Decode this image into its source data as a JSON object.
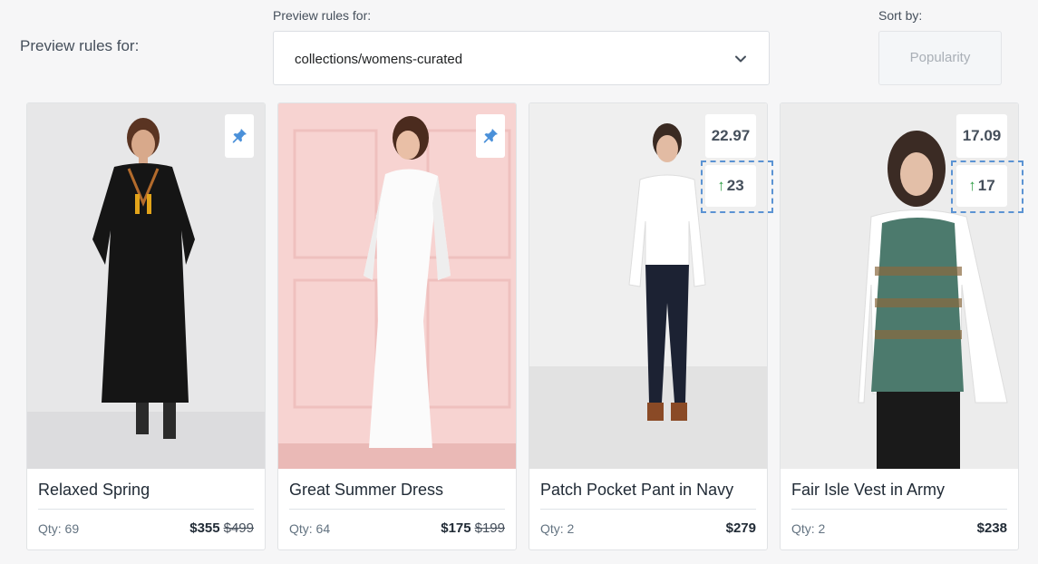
{
  "header": {
    "left_label": "Preview rules for:",
    "collection_label": "Preview rules for:",
    "collection_value": "collections/womens-curated",
    "sort_label": "Sort by:",
    "sort_placeholder": "Popularity"
  },
  "products": [
    {
      "title": "Relaxed Spring",
      "qty": "Qty: 69",
      "price": "$355",
      "compare_price": "$499",
      "pinned": true,
      "icon": "pin-icon"
    },
    {
      "title": "Great Summer Dress",
      "qty": "Qty: 64",
      "price": "$175",
      "compare_price": "$199",
      "pinned": true,
      "icon": "pin-icon"
    },
    {
      "title": "Patch Pocket Pant in Navy",
      "qty": "Qty: 2",
      "price": "$279",
      "score": "22.97",
      "rank_change": "23",
      "icon": "arrow-up-icon"
    },
    {
      "title": "Fair Isle Vest in Army",
      "qty": "Qty: 2",
      "price": "$238",
      "score": "17.09",
      "rank_change": "17",
      "icon": "arrow-up-icon"
    }
  ],
  "colors": {
    "accent": "#4a90d9",
    "rank_up": "#2f9e44",
    "highlight": "#5b93d3"
  }
}
